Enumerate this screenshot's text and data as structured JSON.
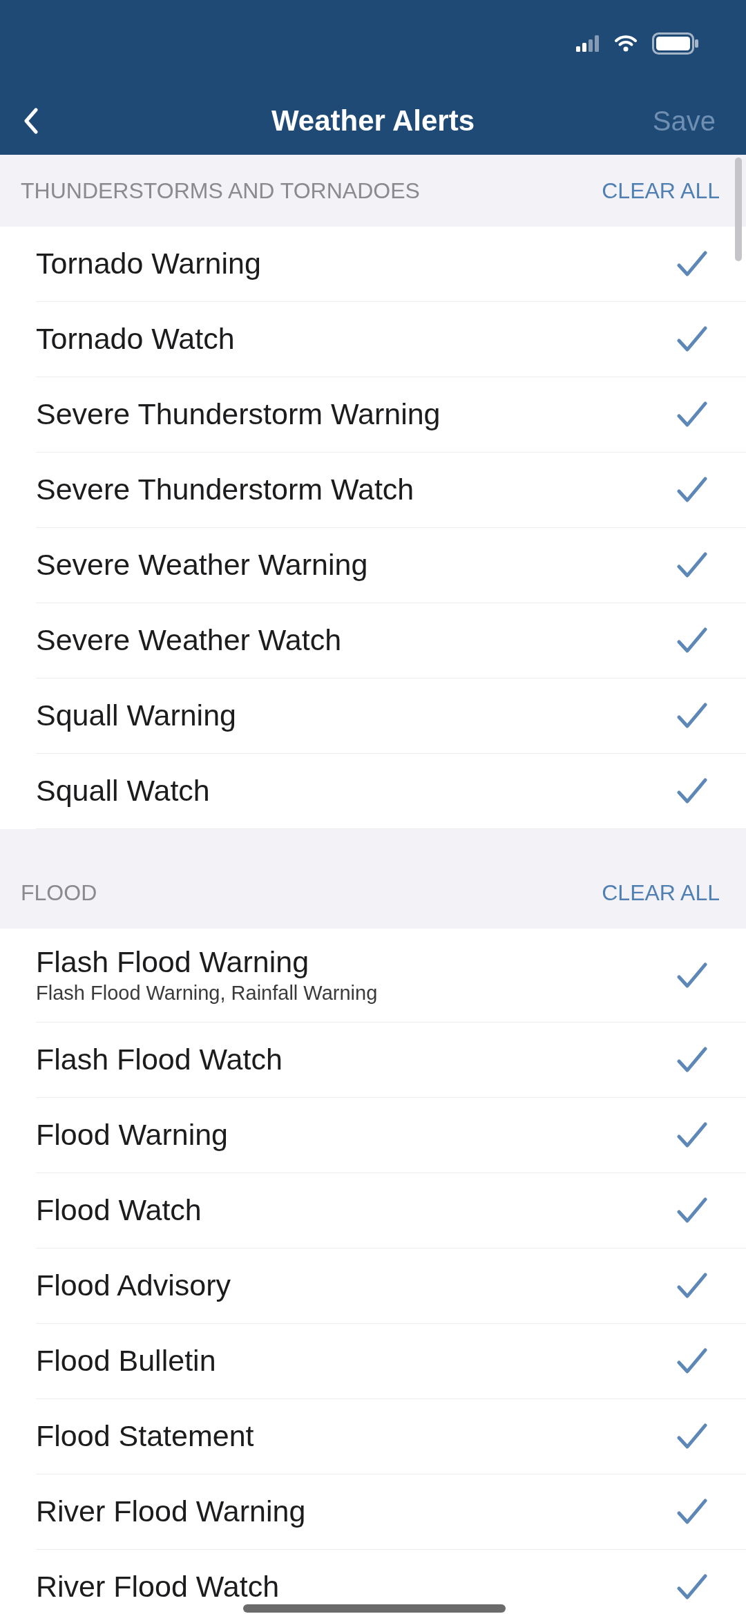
{
  "nav": {
    "title": "Weather Alerts",
    "save": {
      "label": "Save",
      "disabled": true
    }
  },
  "sections": [
    {
      "title": "THUNDERSTORMS AND TORNADOES",
      "action": "CLEAR ALL",
      "items": [
        {
          "label": "Tornado Warning",
          "checked": true
        },
        {
          "label": "Tornado Watch",
          "checked": true
        },
        {
          "label": "Severe Thunderstorm Warning",
          "checked": true
        },
        {
          "label": "Severe Thunderstorm Watch",
          "checked": true
        },
        {
          "label": "Severe Weather Warning",
          "checked": true
        },
        {
          "label": "Severe Weather Watch",
          "checked": true
        },
        {
          "label": "Squall Warning",
          "checked": true
        },
        {
          "label": "Squall Watch",
          "checked": true
        }
      ]
    },
    {
      "title": "FLOOD",
      "action": "CLEAR ALL",
      "items": [
        {
          "label": "Flash Flood Warning",
          "subtitle": "Flash Flood Warning, Rainfall Warning",
          "checked": true
        },
        {
          "label": "Flash Flood Watch",
          "checked": true
        },
        {
          "label": "Flood Warning",
          "checked": true
        },
        {
          "label": "Flood Watch",
          "checked": true
        },
        {
          "label": "Flood Advisory",
          "checked": true
        },
        {
          "label": "Flood Bulletin",
          "checked": true
        },
        {
          "label": "Flood Statement",
          "checked": true
        },
        {
          "label": "River Flood Warning",
          "checked": true
        },
        {
          "label": "River Flood Watch",
          "checked": true
        }
      ]
    }
  ]
}
